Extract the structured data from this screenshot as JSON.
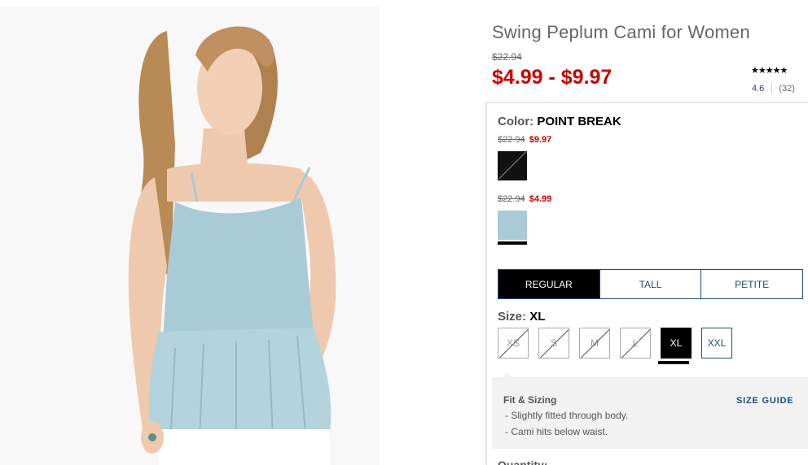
{
  "product": {
    "title": "Swing Peplum Cami for Women",
    "was_price": "$22.94",
    "sale_price": "$4.99 - $9.97",
    "stars": "★★★★★",
    "rating": "4.6",
    "review_count": "(32)"
  },
  "color": {
    "label": "Color:",
    "selected": "POINT BREAK",
    "swatches": [
      {
        "old_price": "$22.94",
        "price": "$9.97",
        "name": "black-swatch",
        "color": "#111111",
        "available": false
      },
      {
        "old_price": "$22.94",
        "price": "$4.99",
        "name": "light-blue-swatch",
        "color": "#a9cbd6",
        "available": true
      }
    ]
  },
  "fit_tabs": [
    {
      "label": "REGULAR",
      "active": true
    },
    {
      "label": "TALL",
      "active": false
    },
    {
      "label": "PETITE",
      "active": false
    }
  ],
  "size": {
    "label": "Size:",
    "selected": "XL",
    "options": [
      "XS",
      "S",
      "M",
      "L",
      "XL",
      "XXL"
    ]
  },
  "fit_sizing": {
    "title": "Fit & Sizing",
    "items": [
      "- Slightly fitted through body.",
      "- Cami hits below waist."
    ],
    "size_guide": "SIZE GUIDE"
  },
  "quantity_label": "Quantity:",
  "colors": {
    "sale": "#cc0000",
    "link": "#1c4d7a",
    "garment": "#a9cbd6"
  }
}
